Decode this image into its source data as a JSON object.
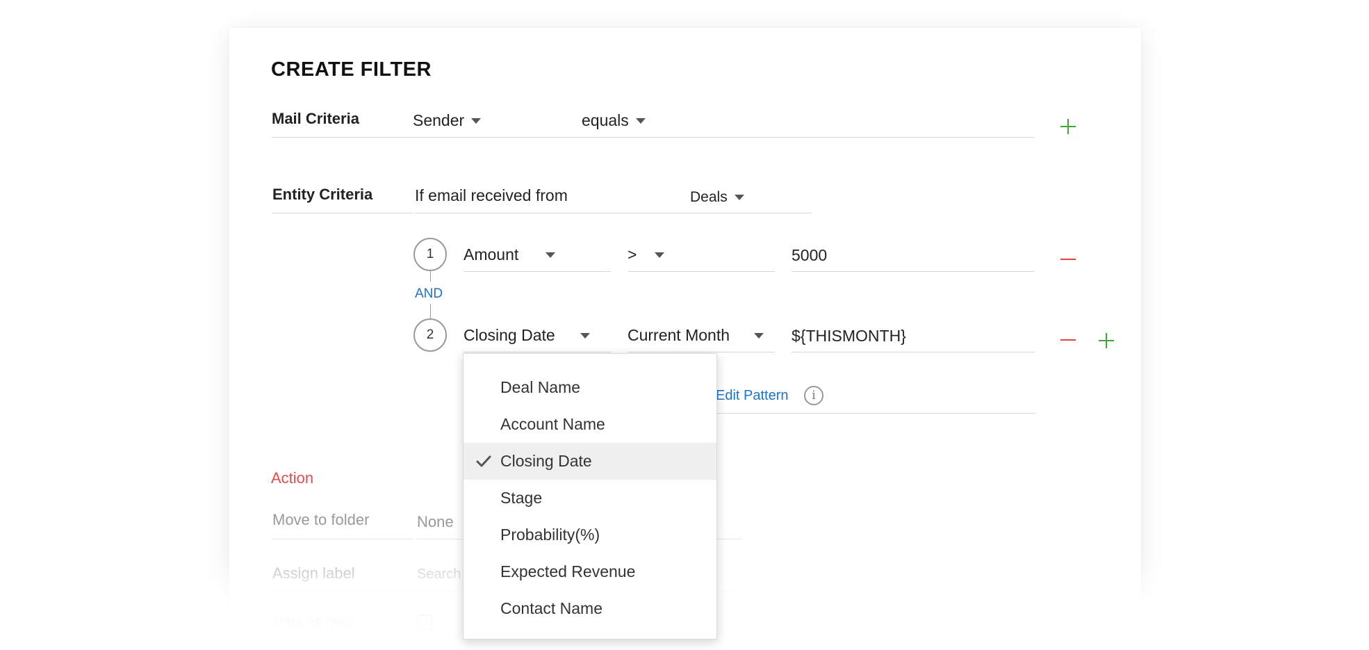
{
  "title": "CREATE FILTER",
  "mail_criteria": {
    "label": "Mail Criteria",
    "field": "Sender",
    "operator": "equals"
  },
  "entity_criteria": {
    "label": "Entity Criteria",
    "prefix": "If email received from",
    "module": "Deals"
  },
  "conditions": [
    {
      "index": "1",
      "field": "Amount",
      "operator": ">",
      "value": "5000"
    },
    {
      "index": "2",
      "field": "Closing Date",
      "operator": "Current Month",
      "value": "${THISMONTH}"
    }
  ],
  "connector": "AND",
  "edit_pattern": "Edit Pattern",
  "info_icon_glyph": "i",
  "action": {
    "heading": "Action",
    "move_to_folder_label": "Move to folder",
    "move_to_folder_value": "None",
    "assign_label_label": "Assign label",
    "assign_label_placeholder": "Search",
    "mark_as_read_label": "Mark as read"
  },
  "field_dropdown": {
    "items": [
      "Deal Name",
      "Account Name",
      "Closing Date",
      "Stage",
      "Probability(%)",
      "Expected Revenue",
      "Contact Name"
    ],
    "selected": "Closing Date"
  },
  "colors": {
    "add": "#3aaa35",
    "remove": "#e0443c",
    "link": "#1a73c8",
    "action_heading": "#e04c4c"
  },
  "icons": [
    "plus-icon",
    "minus-icon",
    "caret-down-icon",
    "check-icon",
    "info-icon"
  ]
}
